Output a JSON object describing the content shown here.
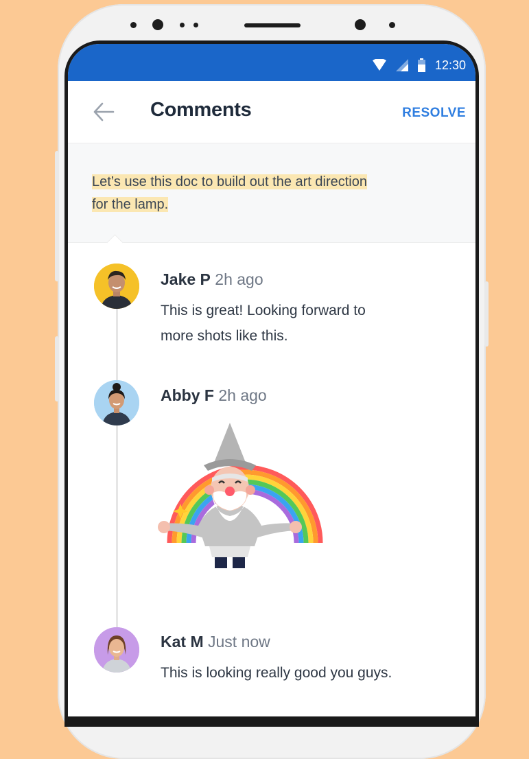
{
  "status_bar": {
    "time": "12:30"
  },
  "header": {
    "title": "Comments",
    "action_label": "RESOLVE"
  },
  "quote": {
    "line1": "Let’s use this doc to build out the art direction",
    "line2": "for the lamp."
  },
  "comments": [
    {
      "author": "Jake P",
      "time": "2h ago",
      "line1": "This is great! Looking forward to",
      "line2": "more shots like this.",
      "avatar_color": "#f5c128"
    },
    {
      "author": "Abby F",
      "time": "2h ago",
      "avatar_color": "#a9d4f2",
      "attachment": "wizard-rainbow-sticker"
    },
    {
      "author": "Kat M",
      "time": "Just now",
      "line1": "This is looking really good you guys.",
      "avatar_color": "#c79be8"
    }
  ],
  "colors": {
    "accent": "#2f7ee0",
    "status_bar": "#1a66c9",
    "highlight": "#fbe7b2",
    "background": "#fcc994"
  }
}
